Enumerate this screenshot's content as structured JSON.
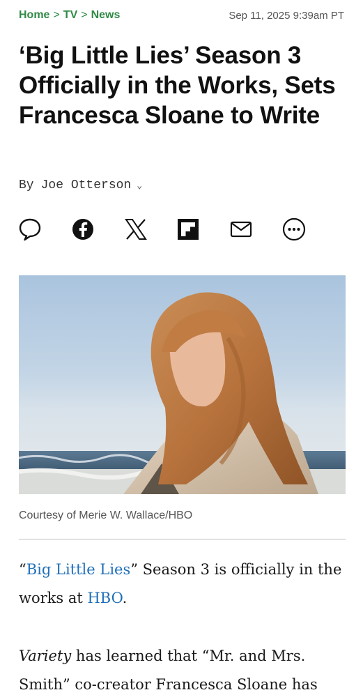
{
  "breadcrumb": {
    "home": "Home",
    "sep": ">",
    "tv": "TV",
    "news": "News"
  },
  "timestamp": "Sep 11, 2025 9:39am PT",
  "headline": "‘Big Little Lies’ Season 3 Officially in the Works, Sets Francesca Sloane to Write",
  "byline": {
    "by": "By",
    "author": "Joe Otterson",
    "chevron": "⌄"
  },
  "share_icons": [
    "comment-icon",
    "facebook-icon",
    "x-icon",
    "flipboard-icon",
    "email-icon",
    "more-icon"
  ],
  "hero_caption": "Courtesy of Merie W. Wallace/HBO",
  "article": {
    "p1_open_quote": "“",
    "p1_link_show": "Big Little Lies",
    "p1_mid": "” Season 3 is officially in the works at ",
    "p1_link_network": "HBO",
    "p1_end": ".",
    "p2_publication": "Variety",
    "p2_text": " has learned that “Mr. and Mrs. Smith” co-creator Francesca Sloane has"
  },
  "colors": {
    "breadcrumb": "#2f8a45",
    "link": "#1f6fb8",
    "rule": "#bfbfbf"
  }
}
